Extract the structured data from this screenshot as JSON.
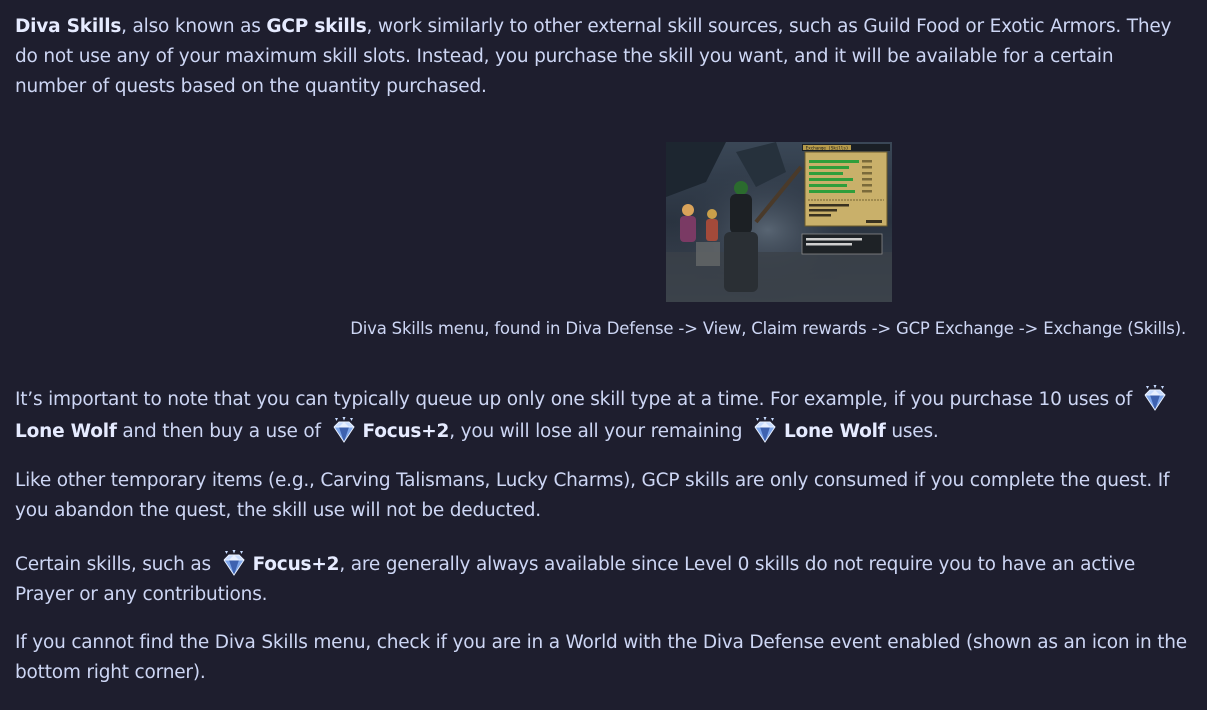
{
  "intro": {
    "b1": "Diva Skills",
    "t1": ", also known as ",
    "b2": "GCP skills",
    "t2": ", work similarly to other external skill sources, such as Guild Food or Exotic Armors. They do not use any of your maximum skill slots. Instead, you purchase the skill you want, and it will be available for a certain number of quests based on the quantity purchased."
  },
  "figure": {
    "caption": "Diva Skills menu, found in Diva Defense -> View, Claim rewards -> GCP Exchange -> Exchange (Skills).",
    "menu_header": "Exchange (Skills)",
    "menu_items": [
      "Lone Wolf",
      "Focus+2"
    ],
    "colors": {
      "menu_bg": "#c9b06a",
      "menu_text": "#2f9e3b"
    }
  },
  "p1": {
    "t1": "It’s important to note that you can typically queue up only one skill type at a time. For example, if you purchase 10 uses of ",
    "b1": "Lone Wolf",
    "t2": " and then buy a use of ",
    "b2": "Focus+2",
    "t3": ", you will lose all your remaining ",
    "b3": "Lone Wolf",
    "t4": " uses."
  },
  "p2": {
    "text": "Like other temporary items (e.g., Carving Talismans, Lucky Charms), GCP skills are only consumed if you complete the quest. If you abandon the quest, the skill use will not be deducted."
  },
  "p3": {
    "t1": "Certain skills, such as ",
    "b1": "Focus+2",
    "t2": ", are generally always available since Level 0 skills do not require you to have an active Prayer or any contributions."
  },
  "p4": {
    "text": "If you cannot find the Diva Skills menu, check if you are in a World with the Diva Defense event enabled (shown as an icon in the bottom right corner)."
  },
  "icons": {
    "gem": "diva-gem-icon",
    "gem_colors": {
      "light": "#c8dcff",
      "mid": "#7ea6ea",
      "dark": "#3e62b0"
    }
  },
  "theme": {
    "background": "#1e1e2e",
    "text": "#cdd6f4"
  }
}
